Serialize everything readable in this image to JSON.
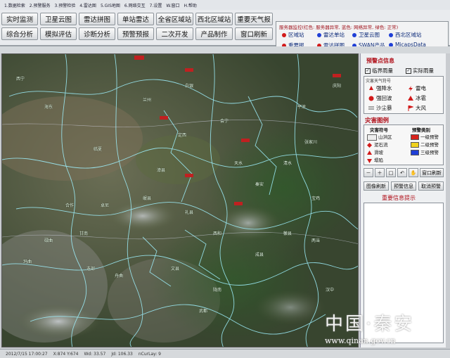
{
  "menu": [
    "1.数据检索",
    "2.预警服务",
    "3.预警检验",
    "4.雷达图",
    "5.GIS地图",
    "6.网络交互",
    "7.设置",
    "W.窗口",
    "H.帮助"
  ],
  "toolbar_row1": [
    "实时监测",
    "卫星云图",
    "雷达拼图",
    "单站雷达",
    "全省区域站",
    "西北区域站",
    "重要天气报"
  ],
  "toolbar_row2": [
    "综合分析",
    "模拟评估",
    "诊断分析",
    "预警预报",
    "二次开发",
    "产品制作",
    "窗口刷新"
  ],
  "status_panel": {
    "title": "服务器监控(红色: 服务器异常, 蓝色: 网络异常, 绿色: 正常)",
    "items": [
      {
        "label": "区域站",
        "color": "#d21a1a"
      },
      {
        "label": "雷达单站",
        "color": "#1f3fd6"
      },
      {
        "label": "卫星云图",
        "color": "#1f3fd6"
      },
      {
        "label": "西北区域站",
        "color": "#1f3fd6"
      },
      {
        "label": "重要报",
        "color": "#d21a1a"
      },
      {
        "label": "雷达拼图",
        "color": "#d21a1a"
      },
      {
        "label": "SWAN产品",
        "color": "#1f3fd6"
      },
      {
        "label": "MicapsData",
        "color": "#1f3fd6"
      }
    ]
  },
  "map_labels": [
    "西宁",
    "海东",
    "兰州",
    "天水",
    "陇南",
    "定西",
    "临夏",
    "甘南",
    "平凉",
    "庆阳",
    "宝鸡",
    "汉中",
    "武都",
    "岷县",
    "白银",
    "会宁",
    "秦安",
    "清水",
    "张家川",
    "漳县",
    "礼县",
    "西和",
    "成县",
    "徽县",
    "两当",
    "文县",
    "舟曲",
    "迭部",
    "卓尼",
    "合作",
    "碌曲",
    "玛曲"
  ],
  "side": {
    "warning_info": "预警点信息",
    "cb_threshold": "临界雨量",
    "cb_actual": "实际雨量",
    "weather_title": "灾害天气符号",
    "weather": [
      "强降水",
      "雷电",
      "强回波",
      "冰雹",
      "沙尘暴",
      "大风"
    ],
    "disaster_title": "灾害图例",
    "disaster_col1": "灾害符号",
    "disaster_col2": "预警类别",
    "disaster_items": [
      "山洪区",
      "泥石流",
      "滑坡",
      "塌陷"
    ],
    "warn_levels": [
      "一级预警",
      "二级预警",
      "三级预警"
    ],
    "warn_colors": [
      "#d8241c",
      "#f0d21c",
      "#1f3fd6"
    ],
    "tools": [
      "－",
      "＋",
      "□",
      "↶",
      "✋"
    ],
    "btn_refresh_window": "窗口刷新",
    "btn_image_refresh": "图像刷新",
    "btn_warning_info": "预警信息",
    "btn_cancel_warning": "取消预警",
    "important": "重要信息提示"
  },
  "statusbar": {
    "time": "2012/7/15 17:00:27",
    "xy": "X:874  Y:674",
    "lat": "Wd: 33.57",
    "lon": "Jd: 106.33",
    "layer": "nCurLay: 9"
  },
  "watermark": {
    "cn": "中国·秦安",
    "url": "www.qinan.gov.cn"
  }
}
